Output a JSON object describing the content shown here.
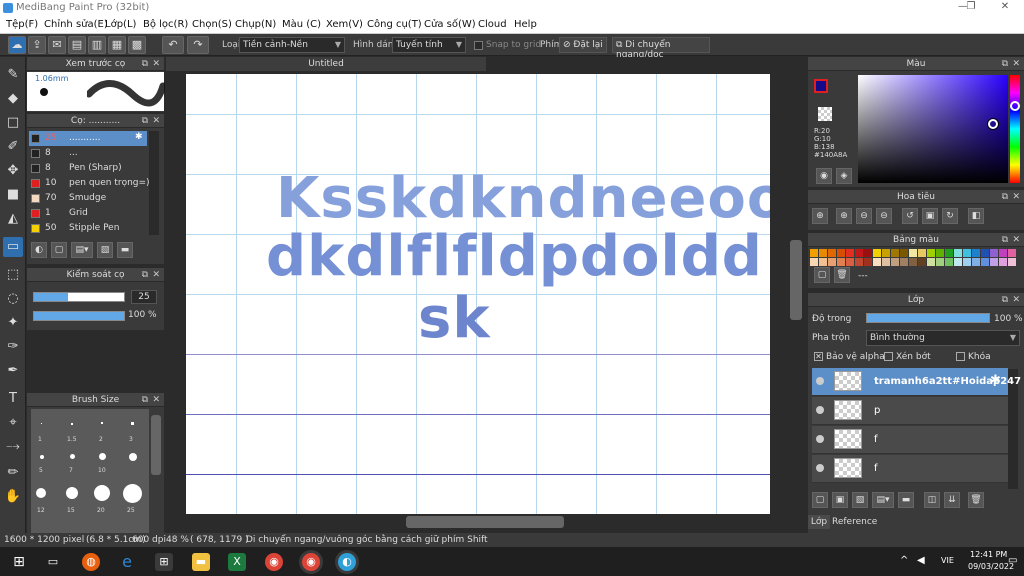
{
  "window": {
    "title": "MediBang Paint Pro (32bit)",
    "minimize": "—",
    "maximize": "❐",
    "close": "✕"
  },
  "menu": [
    "Tệp(F)",
    "Chỉnh sửa(E)",
    "Lớp(L)",
    "Bộ lọc(R)",
    "Chọn(S)",
    "Chụp(N)",
    "Màu (C)",
    "Xem(V)",
    "Công cụ(T)",
    "Cửa số(W)",
    "Cloud",
    "Help"
  ],
  "toolbar": {
    "type_label": "Loại",
    "type_value": "Tiền cảnh-Nền",
    "shape_label": "Hình dáng",
    "shape_value": "Tuyến tính",
    "snap_label": "Snap to grid",
    "key_label": "Phím",
    "reset_label": "Đặt lại",
    "move_label": "Di chuyển ngang/dọc"
  },
  "preview_panel": {
    "title": "Xem trước cọ",
    "size": "1.06mm"
  },
  "brush_panel": {
    "title": "Cọ: ...........",
    "items": [
      {
        "color": "#222222",
        "size": "25",
        "name": "..........."
      },
      {
        "color": "#222222",
        "size": "8",
        "name": "..."
      },
      {
        "color": "#222222",
        "size": "8",
        "name": "Pen (Sharp)"
      },
      {
        "color": "#e02020",
        "size": "10",
        "name": "pen quen trọng=)"
      },
      {
        "color": "#f3d9c0",
        "size": "70",
        "name": "Smudge"
      },
      {
        "color": "#e02020",
        "size": "1",
        "name": "Grid"
      },
      {
        "color": "#f5d000",
        "size": "50",
        "name": "Stipple Pen"
      }
    ]
  },
  "brush_control": {
    "title": "Kiểm soát cọ",
    "size_value": "25",
    "opacity_value": "100 %",
    "size_fraction": 0.38,
    "opacity_fraction": 1.0
  },
  "brush_size_panel": {
    "title": "Brush Size",
    "labels": [
      "1",
      "1.5",
      "2",
      "3",
      "5",
      "7",
      "10",
      "12",
      "15",
      "20",
      "25"
    ]
  },
  "document": {
    "tab": "Untitled",
    "lines": [
      "Ksskdkndneeoo",
      "dkdlflfldpdoldd l",
      "sk"
    ]
  },
  "color_panel": {
    "title": "Màu",
    "r": "R:20",
    "g": "G:10",
    "b": "B:138",
    "hex": "#140A8A",
    "fg": "#140A8A"
  },
  "navigator_panel": {
    "title": "Hoa tiêu"
  },
  "palette_panel": {
    "title": "Bảng màu",
    "placeholder": "---",
    "row1": [
      "#f0a000",
      "#e88a00",
      "#e06800",
      "#d84e00",
      "#e03020",
      "#c01818",
      "#9a1010",
      "#f0d000",
      "#c8a000",
      "#a07800",
      "#7a5800",
      "#f0e8a0",
      "#e8c860",
      "#a0d000",
      "#60b000",
      "#20a020",
      "#80e0e0",
      "#40c0e0",
      "#2080d0",
      "#2050b0",
      "#9060d0",
      "#c040c0",
      "#e060a0"
    ],
    "row2": [
      "#f8d8b0",
      "#f0c090",
      "#e8a070",
      "#e08050",
      "#d86040",
      "#c04830",
      "#a03020",
      "#f8e0c0",
      "#e0c0a0",
      "#c0a080",
      "#a08060",
      "#806040",
      "#604020",
      "#d0e0a0",
      "#a0d080",
      "#70c060",
      "#c0e8f0",
      "#a0d0f0",
      "#80b0e8",
      "#6090e0",
      "#c0a0e8",
      "#e0a0e0",
      "#f0c0d8"
    ]
  },
  "layer_panel": {
    "title": "Lớp",
    "opacity_label": "Độ trong",
    "opacity_value": "100 %",
    "blend_label": "Pha trộn",
    "blend_value": "Bình thường",
    "alpha_label": "Bảo vệ alpha",
    "clip_label": "Xén bớt",
    "lock_label": "Khóa",
    "layers": [
      "tramanh6a2tt#Hoidap247",
      "p",
      "f",
      "f"
    ],
    "tab_layer": "Lớp",
    "tab_reference": "Reference"
  },
  "status": {
    "size": "1600 * 1200 pixel",
    "dims": "(6.8 * 5.1cm)",
    "dpi": "600 dpi",
    "zoom": "48 %",
    "coords": "( 678, 1179 )",
    "hint": "Di chuyển ngang/vuông góc bằng cách giữ phím Shift"
  },
  "taskbar": {
    "lang": "VIE",
    "time": "12:41 PM",
    "date": "09/03/2022"
  }
}
